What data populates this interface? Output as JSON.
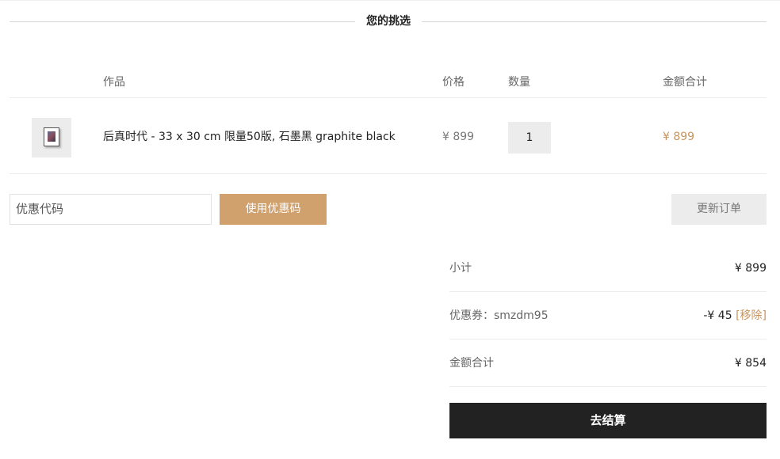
{
  "section": {
    "title": "您的挑选"
  },
  "table": {
    "headers": {
      "product": "作品",
      "price": "价格",
      "quantity": "数量",
      "total": "金额合计"
    },
    "rows": [
      {
        "name": "后真时代 - 33 x 30 cm 限量50版, 石墨黑 graphite black",
        "price": "¥ 899",
        "quantity": "1",
        "total": "¥ 899"
      }
    ]
  },
  "coupon": {
    "placeholder": "优惠代码",
    "apply_label": "使用优惠码"
  },
  "update_label": "更新订单",
  "summary": {
    "subtotal_label": "小计",
    "subtotal_value": "¥ 899",
    "coupon_label": "优惠券：smzdm95",
    "coupon_value": "-¥ 45",
    "coupon_remove": "[移除]",
    "total_label": "金额合计",
    "total_value": "¥ 854"
  },
  "checkout_label": "去结算",
  "colors": {
    "accent": "#c8935d",
    "button_accent": "#d0a06d",
    "dark": "#222222",
    "light_gray": "#ececec"
  }
}
